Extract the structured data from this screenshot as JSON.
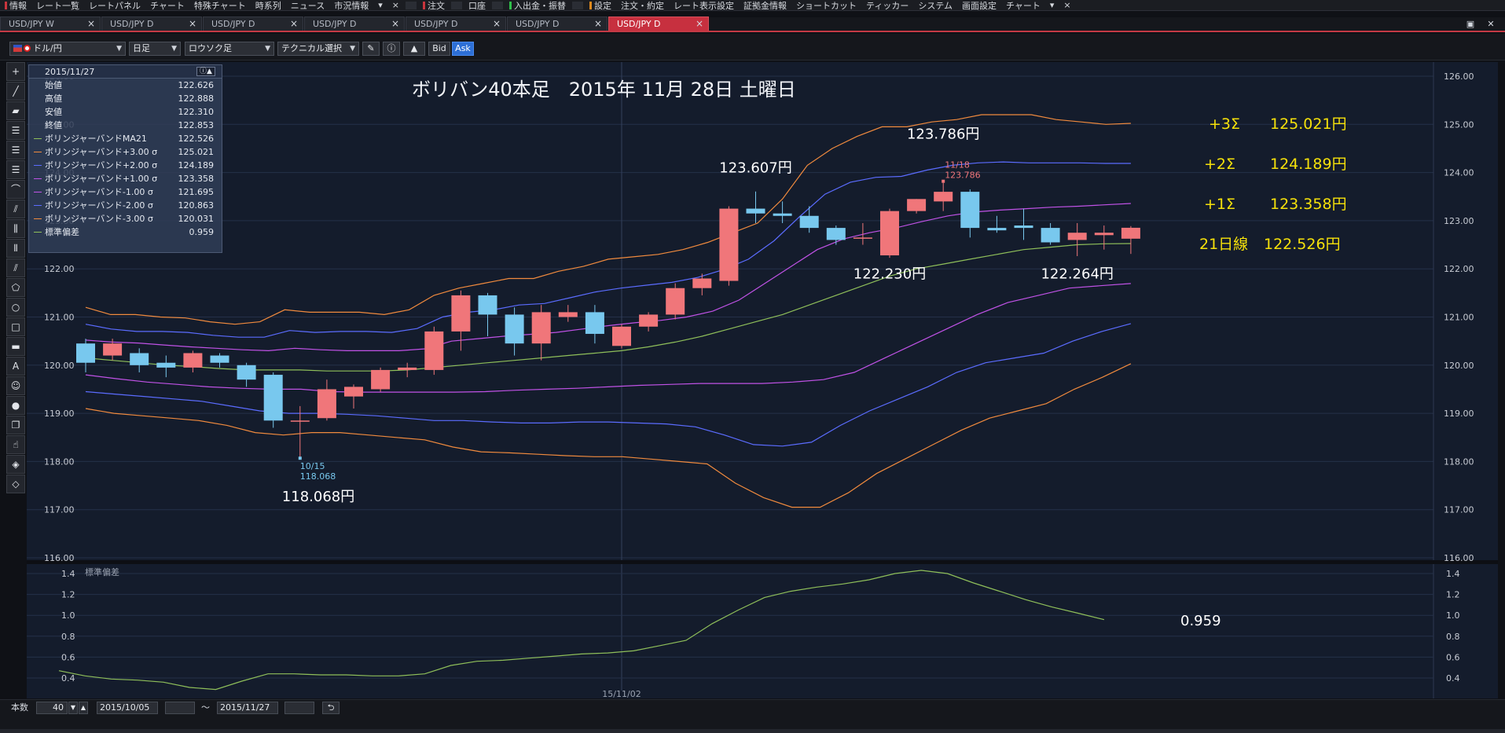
{
  "menubar": {
    "items": [
      {
        "label": "情報",
        "mark": "#c8353d"
      },
      {
        "label": "レート一覧"
      },
      {
        "label": "レートパネル"
      },
      {
        "label": "チャート"
      },
      {
        "label": "特殊チャート"
      },
      {
        "label": "時系列"
      },
      {
        "label": "ニュース"
      },
      {
        "label": "市況情報"
      },
      {
        "label": "▾"
      },
      {
        "label": "×"
      },
      {
        "label": "注文",
        "mark": "#c8353d",
        "gap": true
      },
      {
        "label": "口座",
        "gap": true
      },
      {
        "label": "入出金・振替",
        "mark": "#2fbf4a",
        "gap": true
      },
      {
        "label": "設定",
        "mark": "#e08a1e",
        "gap": true
      },
      {
        "label": "注文・約定"
      },
      {
        "label": "レート表示設定"
      },
      {
        "label": "証拠金情報"
      },
      {
        "label": "ショートカット"
      },
      {
        "label": "ティッカー"
      },
      {
        "label": "システム"
      },
      {
        "label": "画面設定"
      },
      {
        "label": "チャート"
      },
      {
        "label": "▾"
      },
      {
        "label": "×"
      }
    ]
  },
  "tabs": [
    {
      "label": "USD/JPY W",
      "close": "×"
    },
    {
      "label": "USD/JPY D",
      "close": "×"
    },
    {
      "label": "USD/JPY D",
      "close": "×"
    },
    {
      "label": "USD/JPY D",
      "close": "×"
    },
    {
      "label": "USD/JPY D",
      "close": "×"
    },
    {
      "label": "USD/JPY D",
      "close": "×"
    },
    {
      "label": "USD/JPY D",
      "close": "×",
      "active": true
    }
  ],
  "window_buttons": [
    "▣",
    "✕"
  ],
  "toolbar": {
    "pair": "ドル/円",
    "timeframe": "日足",
    "chart_type": "ロウソク足",
    "technical": "テクニカル選択",
    "bid": "Bid",
    "ask": "Ask"
  },
  "tools": [
    "+",
    "╱",
    "▰",
    "☰",
    "☰",
    "☰",
    "⌒",
    "⫽",
    "⫼",
    "⦀",
    "⫽",
    "⬠",
    "○",
    "□",
    "▬",
    "A",
    "☺",
    "●",
    "❐",
    "☝",
    "◈",
    "◇"
  ],
  "info": {
    "date": "2015/11/27",
    "rows": [
      {
        "label": "始値",
        "value": "122.626"
      },
      {
        "label": "高値",
        "value": "122.888"
      },
      {
        "label": "安値",
        "value": "122.310"
      },
      {
        "label": "終値",
        "value": "122.853"
      },
      {
        "label": "ボリンジャーバンドMA21",
        "value": "122.526",
        "color": "#8fbf5a"
      },
      {
        "label": "ボリンジャーバンド+3.00 σ",
        "value": "125.021",
        "color": "#f08a3e"
      },
      {
        "label": "ボリンジャーバンド+2.00 σ",
        "value": "124.189",
        "color": "#5b6cff"
      },
      {
        "label": "ボリンジャーバンド+1.00 σ",
        "value": "123.358",
        "color": "#c052e6"
      },
      {
        "label": "ボリンジャーバンド-1.00 σ",
        "value": "121.695",
        "color": "#c052e6"
      },
      {
        "label": "ボリンジャーバンド-2.00 σ",
        "value": "120.863",
        "color": "#5b6cff"
      },
      {
        "label": "ボリンジャーバンド-3.00 σ",
        "value": "120.031",
        "color": "#f08a3e"
      },
      {
        "label": "標準偏差",
        "value": "0.959",
        "color": "#8fbf5a"
      }
    ]
  },
  "chart_data": {
    "type": "candlestick",
    "title": "ボリバン40本足　2015年 11月 28日 土曜日",
    "y_ticks": [
      "126.00",
      "125.00",
      "124.00",
      "123.00",
      "122.00",
      "121.00",
      "120.00",
      "119.00",
      "118.00",
      "117.00",
      "116.00"
    ],
    "ylim": [
      116,
      126
    ],
    "x_label": "15/11/02",
    "x_label_index": 20,
    "candles": [
      {
        "o": 120.45,
        "h": 120.55,
        "l": 119.85,
        "c": 120.05
      },
      {
        "o": 120.2,
        "h": 120.55,
        "l": 120.1,
        "c": 120.45
      },
      {
        "o": 120.25,
        "h": 120.35,
        "l": 119.85,
        "c": 120.0
      },
      {
        "o": 120.05,
        "h": 120.2,
        "l": 119.75,
        "c": 119.95
      },
      {
        "o": 119.95,
        "h": 120.3,
        "l": 119.85,
        "c": 120.25
      },
      {
        "o": 120.2,
        "h": 120.25,
        "l": 119.95,
        "c": 120.05
      },
      {
        "o": 120.0,
        "h": 120.05,
        "l": 119.55,
        "c": 119.7
      },
      {
        "o": 119.8,
        "h": 119.85,
        "l": 118.7,
        "c": 118.85
      },
      {
        "o": 118.85,
        "h": 119.15,
        "l": 118.068,
        "c": 118.85
      },
      {
        "o": 118.9,
        "h": 119.7,
        "l": 118.85,
        "c": 119.5
      },
      {
        "o": 119.35,
        "h": 119.6,
        "l": 119.1,
        "c": 119.55
      },
      {
        "o": 119.5,
        "h": 119.95,
        "l": 119.45,
        "c": 119.9
      },
      {
        "o": 119.9,
        "h": 120.05,
        "l": 119.75,
        "c": 119.95
      },
      {
        "o": 119.9,
        "h": 120.8,
        "l": 119.8,
        "c": 120.7
      },
      {
        "o": 120.7,
        "h": 121.55,
        "l": 120.3,
        "c": 121.45
      },
      {
        "o": 121.45,
        "h": 121.5,
        "l": 120.6,
        "c": 121.05
      },
      {
        "o": 121.05,
        "h": 121.2,
        "l": 120.2,
        "c": 120.45
      },
      {
        "o": 120.45,
        "h": 121.25,
        "l": 120.1,
        "c": 121.1
      },
      {
        "o": 121.0,
        "h": 121.25,
        "l": 120.9,
        "c": 121.1
      },
      {
        "o": 121.1,
        "h": 121.25,
        "l": 120.45,
        "c": 120.65
      },
      {
        "o": 120.4,
        "h": 120.85,
        "l": 120.35,
        "c": 120.8
      },
      {
        "o": 120.8,
        "h": 121.1,
        "l": 120.7,
        "c": 121.05
      },
      {
        "o": 121.05,
        "h": 121.7,
        "l": 120.95,
        "c": 121.6
      },
      {
        "o": 121.6,
        "h": 121.9,
        "l": 121.45,
        "c": 121.8
      },
      {
        "o": 121.75,
        "h": 123.3,
        "l": 121.65,
        "c": 123.25
      },
      {
        "o": 123.25,
        "h": 123.607,
        "l": 122.95,
        "c": 123.15
      },
      {
        "o": 123.15,
        "h": 123.4,
        "l": 122.95,
        "c": 123.1
      },
      {
        "o": 123.1,
        "h": 123.3,
        "l": 122.75,
        "c": 122.85
      },
      {
        "o": 122.85,
        "h": 122.9,
        "l": 122.5,
        "c": 122.6
      },
      {
        "o": 122.65,
        "h": 122.95,
        "l": 122.5,
        "c": 122.65
      },
      {
        "o": 122.28,
        "h": 123.25,
        "l": 122.23,
        "c": 123.2
      },
      {
        "o": 123.2,
        "h": 123.45,
        "l": 123.15,
        "c": 123.45
      },
      {
        "o": 123.4,
        "h": 123.786,
        "l": 123.2,
        "c": 123.6
      },
      {
        "o": 123.6,
        "h": 123.65,
        "l": 122.65,
        "c": 122.85
      },
      {
        "o": 122.85,
        "h": 123.1,
        "l": 122.75,
        "c": 122.8
      },
      {
        "o": 122.9,
        "h": 123.25,
        "l": 122.6,
        "c": 122.85
      },
      {
        "o": 122.85,
        "h": 122.95,
        "l": 122.5,
        "c": 122.55
      },
      {
        "o": 122.6,
        "h": 122.95,
        "l": 122.264,
        "c": 122.75
      },
      {
        "o": 122.7,
        "h": 122.9,
        "l": 122.4,
        "c": 122.75
      },
      {
        "o": 122.626,
        "h": 122.888,
        "l": 122.31,
        "c": 122.853
      }
    ],
    "series": [
      {
        "key": "p3",
        "color": "#f08a3e",
        "values": [
          121.2,
          121.05,
          121.05,
          121.0,
          120.98,
          120.9,
          120.85,
          120.9,
          121.15,
          121.1,
          121.1,
          121.1,
          121.05,
          121.15,
          121.45,
          121.6,
          121.7,
          121.8,
          121.8,
          121.95,
          122.05,
          122.2,
          122.25,
          122.3,
          122.4,
          122.55,
          122.75,
          122.95,
          123.45,
          124.15,
          124.5,
          124.75,
          124.95,
          124.95,
          125.05,
          125.1,
          125.2,
          125.2,
          125.2,
          125.1,
          125.05,
          125.0,
          125.021
        ]
      },
      {
        "key": "p2",
        "color": "#5b6cff",
        "values": [
          120.85,
          120.75,
          120.7,
          120.7,
          120.68,
          120.62,
          120.58,
          120.58,
          120.72,
          120.68,
          120.7,
          120.7,
          120.68,
          120.76,
          121.0,
          121.1,
          121.15,
          121.25,
          121.28,
          121.4,
          121.52,
          121.6,
          121.66,
          121.72,
          121.82,
          121.98,
          122.2,
          122.58,
          123.08,
          123.55,
          123.8,
          123.9,
          123.92,
          124.05,
          124.15,
          124.2,
          124.22,
          124.2,
          124.2,
          124.2,
          124.19,
          124.189
        ]
      },
      {
        "key": "p1",
        "color": "#c052e6",
        "values": [
          120.52,
          120.48,
          120.46,
          120.42,
          120.38,
          120.35,
          120.32,
          120.3,
          120.35,
          120.32,
          120.3,
          120.3,
          120.3,
          120.34,
          120.5,
          120.55,
          120.6,
          120.64,
          120.68,
          120.75,
          120.82,
          120.88,
          120.93,
          121.0,
          121.12,
          121.35,
          121.7,
          122.05,
          122.4,
          122.62,
          122.75,
          122.85,
          122.98,
          123.1,
          123.18,
          123.22,
          123.25,
          123.28,
          123.3,
          123.33,
          123.358
        ]
      },
      {
        "key": "ma",
        "color": "#8fbf5a",
        "values": [
          120.15,
          120.1,
          120.05,
          120.0,
          119.97,
          119.93,
          119.9,
          119.9,
          119.9,
          119.88,
          119.88,
          119.88,
          119.9,
          119.95,
          120.0,
          120.05,
          120.1,
          120.15,
          120.2,
          120.25,
          120.3,
          120.38,
          120.48,
          120.6,
          120.75,
          120.9,
          121.05,
          121.25,
          121.45,
          121.65,
          121.85,
          122.0,
          122.1,
          122.2,
          122.3,
          122.4,
          122.45,
          122.5,
          122.52,
          122.526
        ]
      },
      {
        "key": "m1",
        "color": "#c052e6",
        "values": [
          119.8,
          119.72,
          119.65,
          119.6,
          119.55,
          119.52,
          119.5,
          119.5,
          119.45,
          119.44,
          119.44,
          119.44,
          119.44,
          119.45,
          119.48,
          119.5,
          119.52,
          119.55,
          119.58,
          119.6,
          119.62,
          119.62,
          119.62,
          119.65,
          119.7,
          119.85,
          120.15,
          120.45,
          120.75,
          121.05,
          121.3,
          121.45,
          121.6,
          121.65,
          121.695
        ]
      },
      {
        "key": "m2",
        "color": "#5b6cff",
        "values": [
          119.45,
          119.4,
          119.35,
          119.3,
          119.25,
          119.15,
          119.05,
          119.0,
          119.0,
          118.98,
          118.95,
          118.9,
          118.85,
          118.85,
          118.82,
          118.8,
          118.8,
          118.82,
          118.82,
          118.8,
          118.78,
          118.72,
          118.55,
          118.35,
          118.32,
          118.4,
          118.75,
          119.05,
          119.3,
          119.55,
          119.85,
          120.05,
          120.15,
          120.25,
          120.5,
          120.7,
          120.863
        ]
      },
      {
        "key": "m3",
        "color": "#f08a3e",
        "values": [
          119.1,
          119.0,
          118.95,
          118.9,
          118.85,
          118.75,
          118.6,
          118.55,
          118.6,
          118.6,
          118.55,
          118.5,
          118.45,
          118.3,
          118.2,
          118.18,
          118.15,
          118.12,
          118.1,
          118.1,
          118.05,
          118.0,
          117.95,
          117.55,
          117.25,
          117.05,
          117.05,
          117.35,
          117.75,
          118.05,
          118.35,
          118.65,
          118.9,
          119.05,
          119.2,
          119.5,
          119.75,
          120.031
        ]
      }
    ],
    "annotations": {
      "low_date": "10/15",
      "low_value": "118.068",
      "low_label": "118.068円",
      "high_date": "11/18",
      "high_value": "123.786",
      "labels": [
        {
          "text": "123.607円",
          "index": 25,
          "price": 124.0
        },
        {
          "text": "123.786円",
          "index": 32,
          "price": 124.7
        },
        {
          "text": "122.230円",
          "index": 30,
          "price": 121.8
        },
        {
          "text": "122.264円",
          "index": 37,
          "price": 121.8
        }
      ],
      "right_labels": [
        {
          "sign": "+3Σ",
          "value": "125.021円",
          "price": 125.021
        },
        {
          "sign": "+2Σ",
          "value": "124.189円",
          "price": 124.189
        },
        {
          "sign": "+1Σ",
          "value": "123.358円",
          "price": 123.358
        },
        {
          "sign": "21日線",
          "value": "122.526円",
          "price": 122.526
        }
      ]
    },
    "sub_chart": {
      "label": "標準偏差",
      "y_ticks": [
        "1.4",
        "1.2",
        "1.0",
        "0.8",
        "0.6",
        "0.4"
      ],
      "ylim": [
        0.24,
        1.5
      ],
      "color": "#8fbf5a",
      "values": [
        0.47,
        0.42,
        0.39,
        0.38,
        0.36,
        0.31,
        0.29,
        0.37,
        0.44,
        0.44,
        0.43,
        0.43,
        0.42,
        0.42,
        0.44,
        0.52,
        0.56,
        0.57,
        0.59,
        0.61,
        0.63,
        0.64,
        0.66,
        0.71,
        0.76,
        0.92,
        1.05,
        1.17,
        1.23,
        1.27,
        1.3,
        1.34,
        1.4,
        1.43,
        1.4,
        1.31,
        1.23,
        1.15,
        1.08,
        1.02,
        0.959
      ],
      "last_label": "0.959"
    }
  },
  "bottombar": {
    "count_label": "本数",
    "count_value": "40",
    "from_date": "2015/10/05",
    "tilde": "～",
    "to_date": "2015/11/27",
    "refresh_icon": "⮌"
  }
}
